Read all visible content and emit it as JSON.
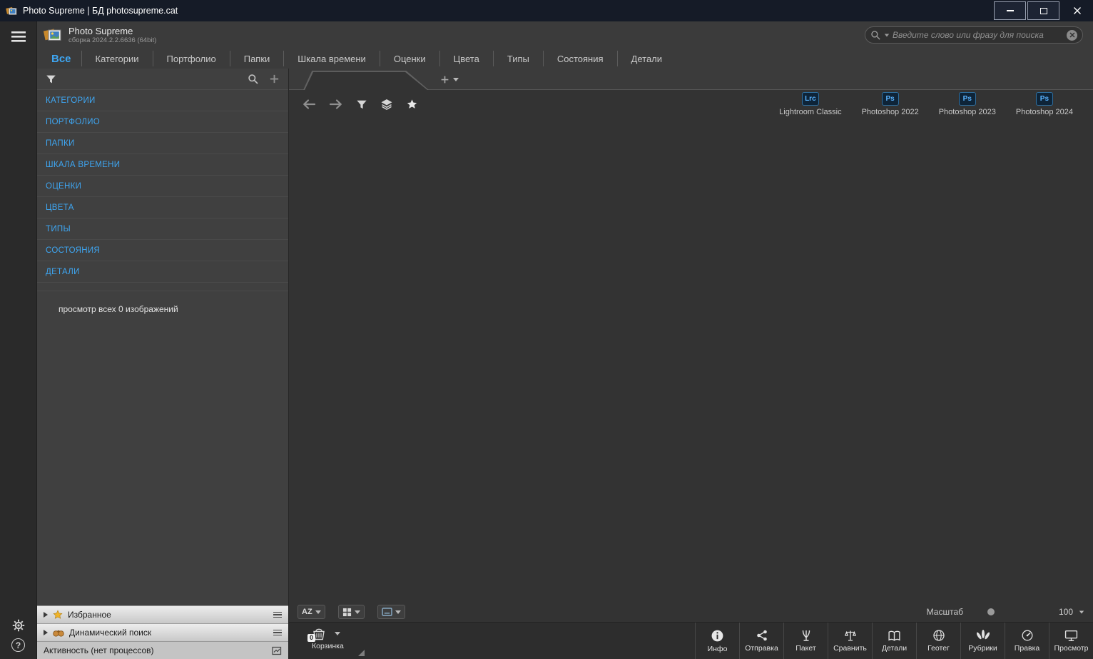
{
  "colors": {
    "accent": "#3ea6f2",
    "badge-bg": "#0e2438",
    "badge-fg": "#5ab3ff",
    "star": "#f0b429"
  },
  "titlebar": {
    "title": "Photo Supreme | БД photosupreme.cat"
  },
  "header": {
    "app_name": "Photo Supreme",
    "build": "сборка 2024.2.2.6636 (64bit)",
    "search": {
      "placeholder": "Введите слово или фразу для поиска",
      "value": ""
    }
  },
  "nav_tabs": [
    {
      "label": "Все"
    },
    {
      "label": "Категории"
    },
    {
      "label": "Портфолио"
    },
    {
      "label": "Папки"
    },
    {
      "label": "Шкала времени"
    },
    {
      "label": "Оценки"
    },
    {
      "label": "Цвета"
    },
    {
      "label": "Типы"
    },
    {
      "label": "Состояния"
    },
    {
      "label": "Детали"
    }
  ],
  "catalog": {
    "items": [
      {
        "label": "КАТЕГОРИИ"
      },
      {
        "label": "ПОРТФОЛИО"
      },
      {
        "label": "ПАПКИ"
      },
      {
        "label": "ШКАЛА ВРЕМЕНИ"
      },
      {
        "label": "ОЦЕНКИ"
      },
      {
        "label": "ЦВЕТА"
      },
      {
        "label": "ТИПЫ"
      },
      {
        "label": "СОСТОЯНИЯ"
      },
      {
        "label": "ДЕТАЛИ"
      }
    ],
    "view_all": "просмотр всех 0 изображений"
  },
  "collapse_panels": [
    {
      "label": "Избранное"
    },
    {
      "label": "Динамический поиск"
    },
    {
      "label": "Активность (нет процессов)"
    }
  ],
  "workspace": {
    "launchers": [
      {
        "badge": "Lrc",
        "label": "Lightroom Classic"
      },
      {
        "badge": "Ps",
        "label": "Photoshop 2022"
      },
      {
        "badge": "Ps",
        "label": "Photoshop 2023"
      },
      {
        "badge": "Ps",
        "label": "Photoshop 2024"
      }
    ]
  },
  "sort_bar": {
    "sort_label": "AZ",
    "zoom_label": "Масштаб",
    "zoom_value": "100"
  },
  "bottom_bar": {
    "basket_label": "Корзинка",
    "basket_count": "0",
    "actions": [
      {
        "label": "Инфо"
      },
      {
        "label": "Отправка"
      },
      {
        "label": "Пакет"
      },
      {
        "label": "Сравнить"
      },
      {
        "label": "Детали"
      },
      {
        "label": "Геотег"
      },
      {
        "label": "Рубрики"
      },
      {
        "label": "Правка"
      },
      {
        "label": "Просмотр"
      }
    ]
  },
  "icons": {
    "help_glyph": "?"
  }
}
